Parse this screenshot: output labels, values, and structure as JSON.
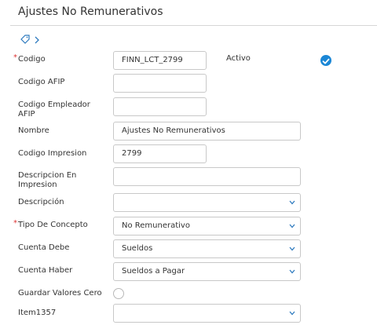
{
  "page": {
    "title": "Ajustes No Remunerativos"
  },
  "toolbar": {
    "tag_icon": "tag-icon",
    "chevron_icon": "chevron-right-icon"
  },
  "form": {
    "codigo": {
      "label": "Codigo",
      "value": "FINN_LCT_2799"
    },
    "activo": {
      "label": "Activo",
      "checked": true
    },
    "codigo_afip": {
      "label": "Codigo AFIP",
      "value": ""
    },
    "codigo_empleador_afip": {
      "label_line1": "Codigo Empleador",
      "label_line2": "AFIP",
      "value": ""
    },
    "nombre": {
      "label": "Nombre",
      "value": "Ajustes No Remunerativos"
    },
    "codigo_impresion": {
      "label": "Codigo Impresion",
      "value": "2799"
    },
    "descripcion_en_impresion": {
      "label_line1": "Descripcion En",
      "label_line2": "Impresion",
      "value": ""
    },
    "descripcion": {
      "label": "Descripción",
      "value": ""
    },
    "tipo_de_concepto": {
      "label": "Tipo De Concepto",
      "value": "No Remunerativo"
    },
    "cuenta_debe": {
      "label": "Cuenta Debe",
      "value": "Sueldos"
    },
    "cuenta_haber": {
      "label": "Cuenta Haber",
      "value": "Sueldos a Pagar"
    },
    "guardar_valores_cero": {
      "label": "Guardar Valores Cero",
      "checked": false
    },
    "item1357": {
      "label": "Item1357",
      "value": ""
    }
  },
  "required_marker": "*",
  "colors": {
    "accent": "#1b87d6",
    "required": "#d33333",
    "chevron": "#2f7bbf"
  }
}
